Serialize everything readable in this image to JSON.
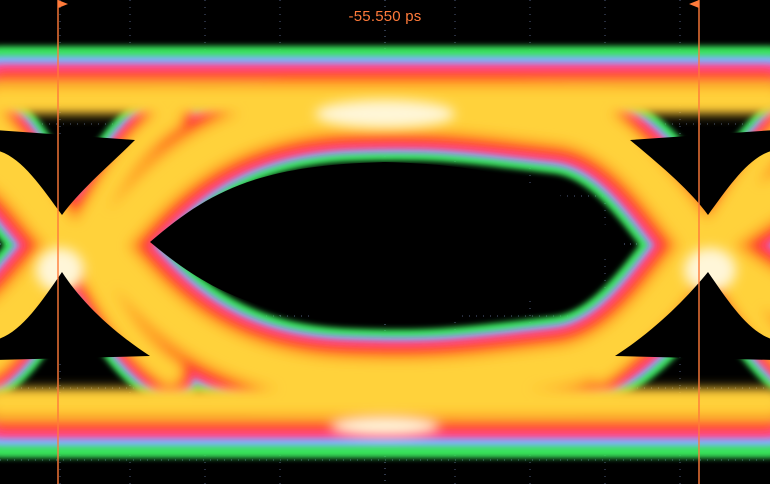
{
  "measurement": {
    "delta_time_label": "-55.550 ps"
  },
  "colors": {
    "background": "#000000",
    "graticule": "#6b7da6",
    "cursor": "#ff7a3a",
    "eye_outer_green": "#39e35a",
    "eye_blue": "#7fb2ff",
    "eye_pink": "#ff4fb0",
    "eye_red": "#ff2a2a",
    "eye_orange": "#ff9a22",
    "eye_yellow": "#ffd23a",
    "eye_white": "#fff6d8"
  }
}
